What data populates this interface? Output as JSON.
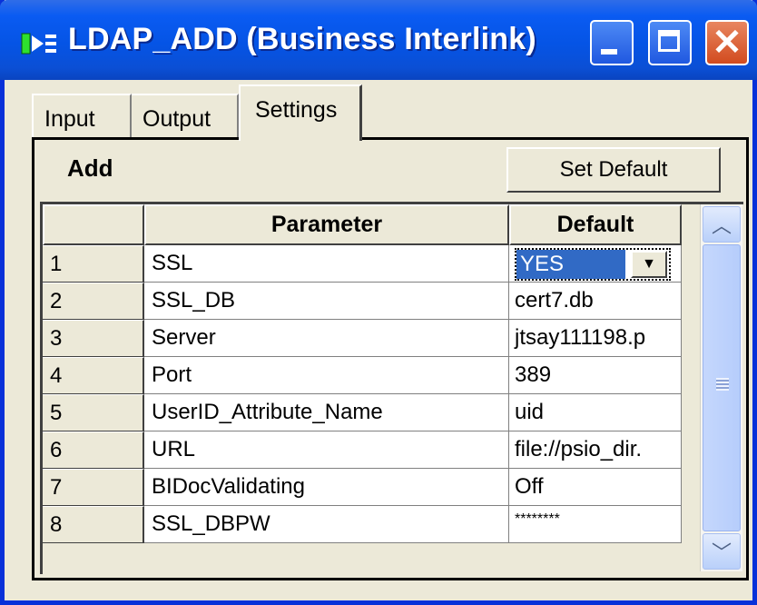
{
  "window": {
    "title": "LDAP_ADD (Business Interlink)",
    "controls": {
      "minimize": "minimize",
      "maximize": "maximize",
      "close": "✕"
    }
  },
  "tabs": [
    {
      "label": "Input",
      "selected": false
    },
    {
      "label": "Output",
      "selected": false
    },
    {
      "label": "Settings",
      "selected": true
    }
  ],
  "panel": {
    "section_label": "Add",
    "set_default_label": "Set Default"
  },
  "grid": {
    "columns": {
      "rownum": "",
      "parameter": "Parameter",
      "default": "Default"
    },
    "rows": [
      {
        "num": "1",
        "parameter": "SSL",
        "default": "YES"
      },
      {
        "num": "2",
        "parameter": "SSL_DB",
        "default": "cert7.db"
      },
      {
        "num": "3",
        "parameter": "Server",
        "default": "jtsay111198.p"
      },
      {
        "num": "4",
        "parameter": "Port",
        "default": "389"
      },
      {
        "num": "5",
        "parameter": "UserID_Attribute_Name",
        "default": "uid"
      },
      {
        "num": "6",
        "parameter": "URL",
        "default": "file://psio_dir."
      },
      {
        "num": "7",
        "parameter": "BIDocValidating",
        "default": "Off"
      },
      {
        "num": "8",
        "parameter": "SSL_DBPW",
        "default": "********"
      }
    ],
    "editing_combo_arrow": "▼"
  },
  "scrollbar": {
    "up": "︿",
    "down": "﹀"
  },
  "colors": {
    "titlebar": "#0554e5",
    "selection": "#316ac5",
    "face": "#ece9d8"
  }
}
